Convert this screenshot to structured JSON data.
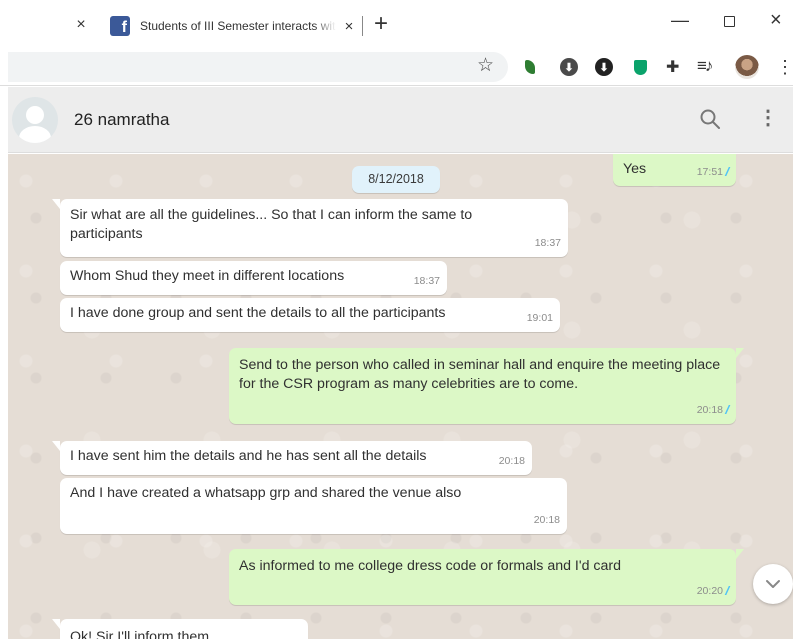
{
  "browser": {
    "tab_title": "Students of III Semester interacts with",
    "tab_close": "×",
    "new_tab": "+",
    "window_minimize": "—",
    "window_close": "×"
  },
  "header": {
    "contact_name": "26 namratha"
  },
  "chat": {
    "date_chip": "8/12/2018",
    "messages": [
      {
        "dir": "out",
        "text": "Yes",
        "time": "17:51",
        "ticks": "//"
      },
      {
        "dir": "in",
        "text": "Sir what are all the guidelines... So that I can inform the same to participants",
        "time": "18:37"
      },
      {
        "dir": "in",
        "text": "Whom Shud they meet in different locations",
        "time": "18:37"
      },
      {
        "dir": "in",
        "text": "I have done group and sent the details to all the participants",
        "time": "19:01"
      },
      {
        "dir": "out",
        "text": "Send to the person who called in seminar hall and enquire the meeting place for the CSR program as many celebrities are to come.",
        "time": "20:18",
        "ticks": "//"
      },
      {
        "dir": "in",
        "text": "I have sent him the details and he has sent all the details",
        "time": "20:18"
      },
      {
        "dir": "in",
        "text": "And I have created a whatsapp grp and shared the venue also",
        "time": "20:18"
      },
      {
        "dir": "out",
        "text": "As informed to me college dress code or formals and I'd card",
        "time": "20:20",
        "ticks": "//"
      },
      {
        "dir": "in",
        "text": "Ok!  Sir  I'll inform them",
        "time": ""
      }
    ]
  },
  "colors": {
    "outgoing_bubble": "#dcf8c6",
    "incoming_bubble": "#ffffff",
    "chat_background": "#e5ddd5",
    "read_ticks": "#4fc3f7"
  }
}
